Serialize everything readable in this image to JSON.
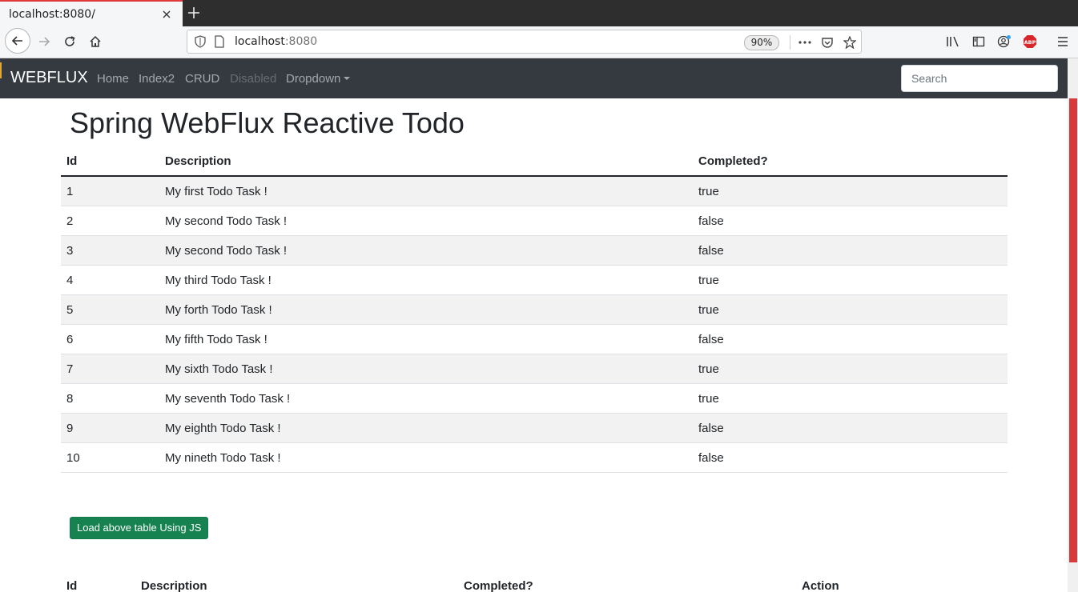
{
  "browser": {
    "tab_title": "localhost:8080/",
    "url_host": "localhost",
    "url_port": ":8080",
    "zoom": "90%",
    "accent_color": "#e0393e"
  },
  "navbar": {
    "brand": "WEBFLUX",
    "links": [
      "Home",
      "Index2",
      "CRUD",
      "Disabled",
      "Dropdown"
    ],
    "search_placeholder": "Search",
    "background": "#343a40"
  },
  "main": {
    "title": "Spring WebFlux Reactive Todo",
    "table": {
      "headers": [
        "Id",
        "Description",
        "Completed?"
      ],
      "rows": [
        [
          "1",
          "My first Todo Task !",
          "true"
        ],
        [
          "2",
          "My second Todo Task !",
          "false"
        ],
        [
          "3",
          "My second Todo Task !",
          "false"
        ],
        [
          "4",
          "My third Todo Task !",
          "true"
        ],
        [
          "5",
          "My forth Todo Task !",
          "true"
        ],
        [
          "6",
          "My fifth Todo Task !",
          "false"
        ],
        [
          "7",
          "My sixth Todo Task !",
          "true"
        ],
        [
          "8",
          "My seventh Todo Task !",
          "true"
        ],
        [
          "9",
          "My eighth Todo Task !",
          "false"
        ],
        [
          "10",
          "My nineth Todo Task !",
          "false"
        ]
      ]
    },
    "load_button": "Load above table Using JS",
    "load_button_color": "#168250",
    "js_table": {
      "headers": [
        "Id",
        "Description",
        "Completed?",
        "Action"
      ]
    }
  }
}
